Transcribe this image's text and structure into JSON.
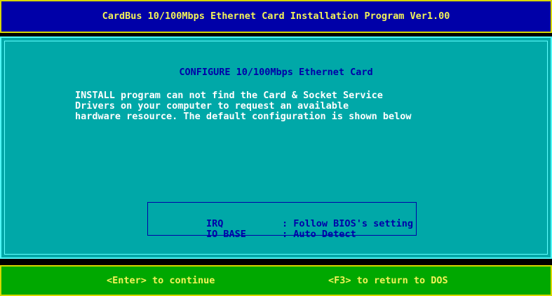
{
  "title": "CardBus 10/100Mbps Ethernet Card Installation Program Ver1.00",
  "heading": "CONFIGURE 10/100Mbps Ethernet Card",
  "message_lines": [
    "INSTALL program can not find the Card & Socket Service",
    "Drivers on your computer to request an available",
    "hardware resource. The default configuration is shown below"
  ],
  "config": [
    {
      "label": "IRQ",
      "value": ": Follow BIOS's setting"
    },
    {
      "label": "IO BASE",
      "value": ": Auto Detect"
    }
  ],
  "footer": {
    "continue": "<Enter> to continue",
    "return_dos": "<F3> to return to DOS"
  },
  "colors": {
    "title_bg": "#0000a8",
    "panel_bg": "#00a8a8",
    "footer_bg": "#00a800",
    "highlight_text": "#f2f258"
  }
}
